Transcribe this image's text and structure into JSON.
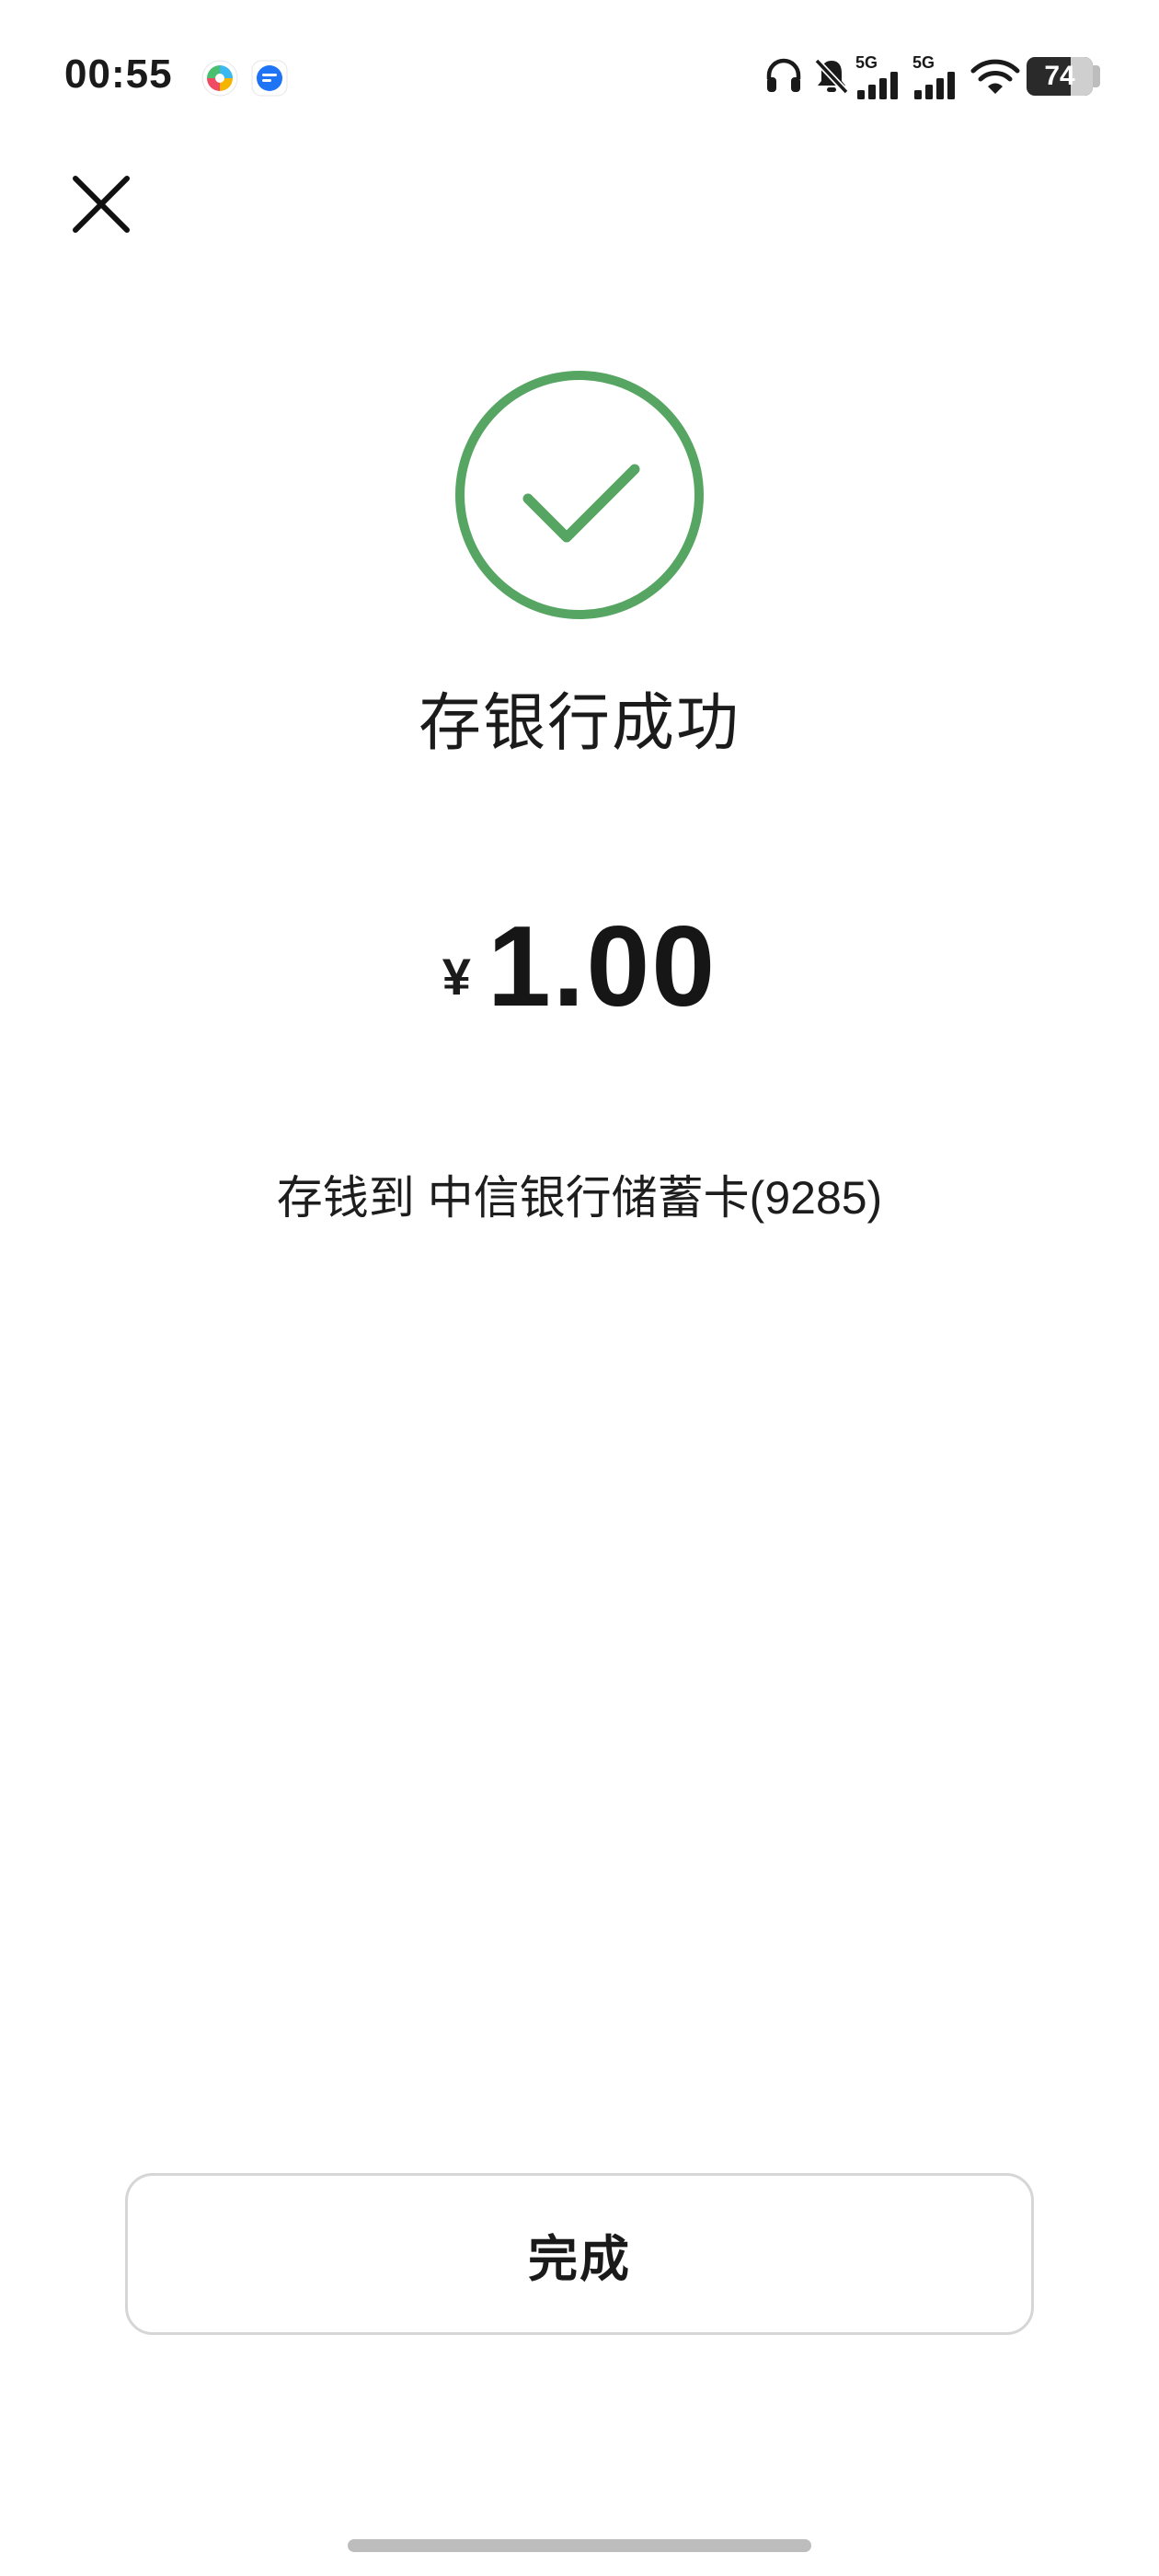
{
  "status_bar": {
    "time": "00:55",
    "network_1": "5G",
    "network_2": "5G",
    "battery": "74",
    "icons": [
      "app-icon-colorful",
      "app-icon-blue",
      "headphones-icon",
      "mute-bell-icon",
      "signal-5g-icon",
      "signal-5g-icon",
      "wifi-icon",
      "battery-icon"
    ]
  },
  "header": {
    "close_icon": "close-icon"
  },
  "result": {
    "icon": "check-circle-icon",
    "title": "存银行成功",
    "currency": "¥",
    "amount": "1.00",
    "deposit_to": "存钱到 中信银行储蓄卡(9285)"
  },
  "actions": {
    "done_label": "完成"
  },
  "colors": {
    "success_green": "#56A562",
    "text": "#1A1A1A",
    "button_border": "#D6D6D6"
  }
}
